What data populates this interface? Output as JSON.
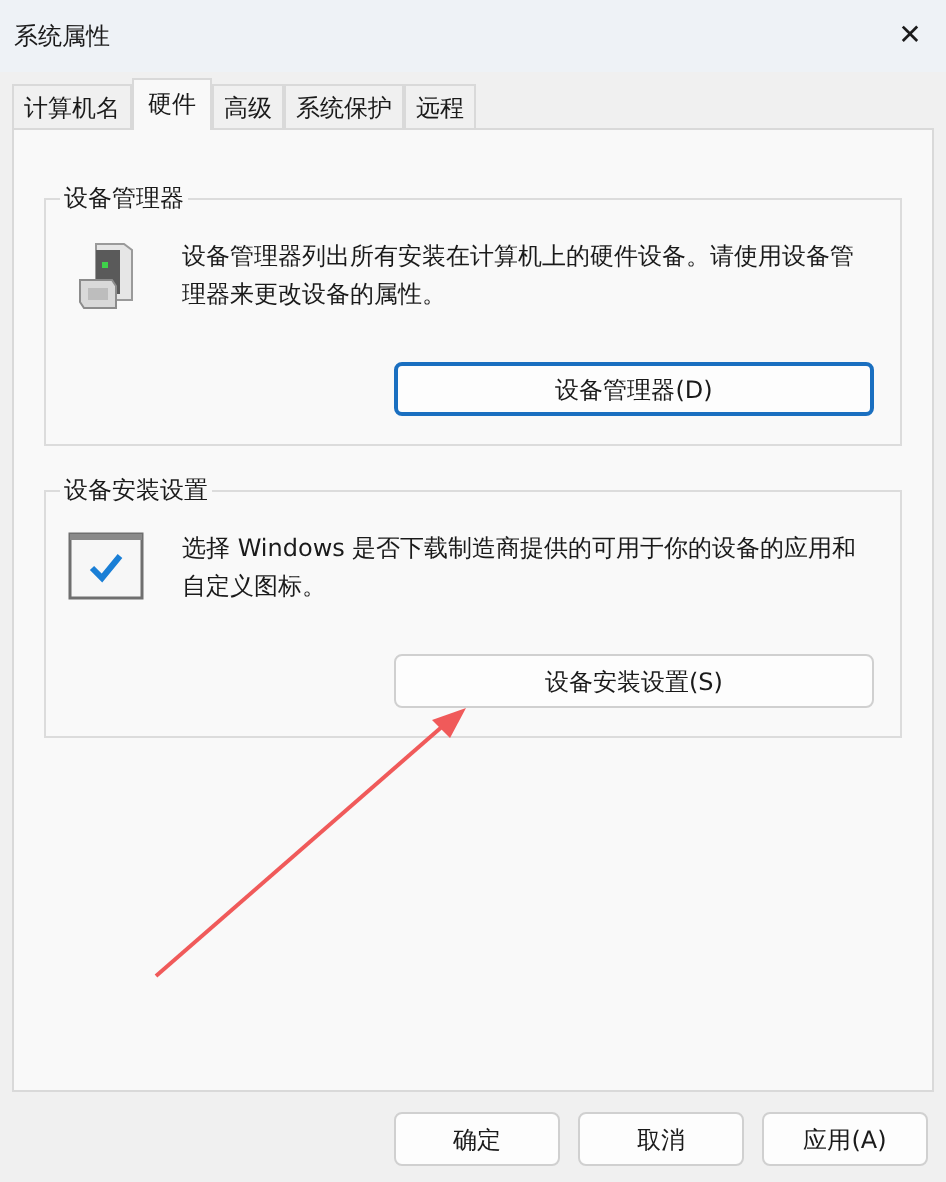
{
  "window": {
    "title": "系统属性",
    "close": "✕"
  },
  "tabs": [
    {
      "label": "计算机名",
      "selected": false
    },
    {
      "label": "硬件",
      "selected": true
    },
    {
      "label": "高级",
      "selected": false
    },
    {
      "label": "系统保护",
      "selected": false
    },
    {
      "label": "远程",
      "selected": false
    }
  ],
  "groups": [
    {
      "kind": "device-manager",
      "title": "设备管理器",
      "description": "设备管理器列出所有安装在计算机上的硬件设备。请使用设备管理器来更改设备的属性。",
      "button": "设备管理器(D)",
      "focused": true
    },
    {
      "kind": "install-settings",
      "title": "设备安装设置",
      "description": "选择 Windows 是否下载制造商提供的可用于你的设备的应用和自定义图标。",
      "button": "设备安装设置(S)",
      "focused": false
    }
  ],
  "footer_buttons": [
    "确定",
    "取消",
    "应用(A)"
  ]
}
